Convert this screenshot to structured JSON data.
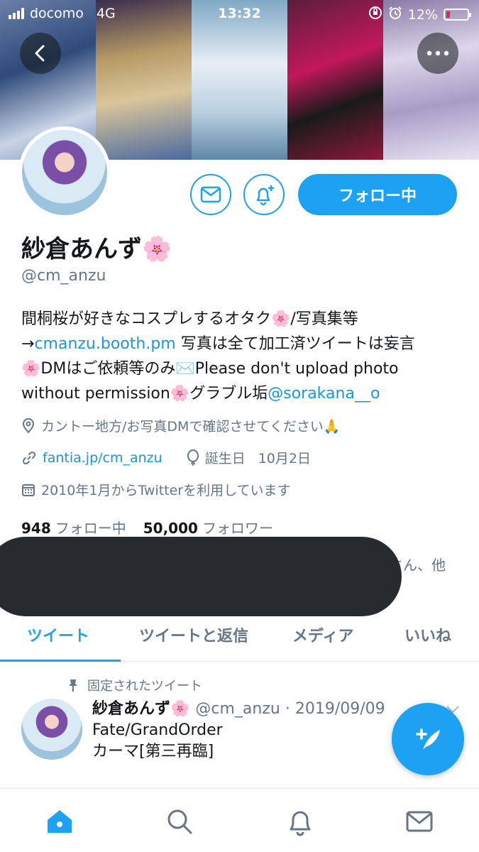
{
  "status_bar": {
    "carrier": "docomo",
    "network": "4G",
    "time": "13:32",
    "battery": "12%"
  },
  "profile": {
    "name": "紗倉あんず🌸",
    "handle": "@cm_anzu",
    "follow_button": "フォロー中",
    "bio": {
      "line1": "間桐桜が好きなコスプレするオタク🌸/写真集等",
      "arrow": "→",
      "booth_link": "cmanzu.booth.pm",
      "line2_rest": " 写真は全て加工済ツイートは妄言",
      "line3": "🌸DMはご依頼等のみ✉️Please don't upload photo",
      "line4": "without permission🌸グラブル垢",
      "mention": "@sorakana__o"
    },
    "location": "カントー地方/お写真DMで確認させてください🙏",
    "website": "fantia.jp/cm_anzu",
    "birthday_label": "誕生日",
    "birthday": "10月2日",
    "joined": "2010年1月からTwitterを利用しています",
    "following_count": "948",
    "following_label": "フォロー中",
    "followers_count": "50,000",
    "followers_label": "フォロワー",
    "followers_you_know_tail": "さん、他"
  },
  "tabs": [
    {
      "label": "ツイート",
      "active": true
    },
    {
      "label": "ツイートと返信",
      "active": false
    },
    {
      "label": "メディア",
      "active": false
    },
    {
      "label": "いいね",
      "active": false
    }
  ],
  "pinned_tweet": {
    "pinned_label": "固定されたツイート",
    "author": "紗倉あんず🌸",
    "handle_date": "@cm_anzu · 2019/09/09",
    "line1": "Fate/GrandOrder",
    "line2": "カーマ[第三再臨]"
  },
  "colors": {
    "accent": "#1da1f2",
    "text_secondary": "#657786",
    "link": "#1b95e0"
  },
  "icons": {
    "back": "chevron-left-icon",
    "more": "more-icon",
    "dm": "envelope-icon",
    "notify": "bell-plus-icon",
    "location": "location-pin-icon",
    "website": "link-icon",
    "birthday": "balloon-icon",
    "joined": "calendar-icon",
    "pin": "pin-icon",
    "compose": "compose-feather-icon",
    "nav": [
      "home-icon",
      "search-icon",
      "bell-icon",
      "envelope-icon"
    ]
  }
}
